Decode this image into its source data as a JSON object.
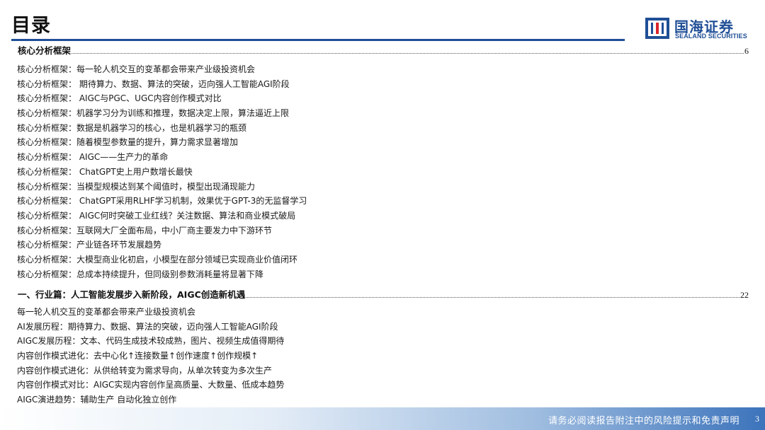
{
  "title": "目录",
  "logo": {
    "cn": "国海证券",
    "en": "SEALAND SECURITIES"
  },
  "sections": [
    {
      "heading": "核心分析框架",
      "page": "6",
      "items": [
        "核心分析框架：每一轮人机交互的变革都会带来产业级投资机会",
        "核心分析框架： 期待算力、数据、算法的突破，迈向强人工智能AGI阶段",
        "核心分析框架： AIGC与PGC、UGC内容创作模式对比",
        "核心分析框架：机器学习分为训练和推理，数据决定上限，算法逼近上限",
        "核心分析框架：数据是机器学习的核心，也是机器学习的瓶颈",
        "核心分析框架：随着模型参数量的提升，算力需求显著增加",
        "核心分析框架： AIGC——生产力的革命",
        "核心分析框架： ChatGPT史上用户数增长最快",
        "核心分析框架：当模型规模达到某个阈值时，模型出现涌现能力",
        "核心分析框架： ChatGPT采用RLHF学习机制，效果优于GPT-3的无监督学习",
        "核心分析框架： AIGC何时突破工业红线？关注数据、算法和商业模式破局",
        "核心分析框架：互联网大厂全面布局，中小厂商主要发力中下游环节",
        "核心分析框架：产业链各环节发展趋势",
        "核心分析框架：大模型商业化初启，小模型在部分领域已实现商业价值闭环",
        "核心分析框架：总成本持续提升，但同级别参数消耗量将显著下降"
      ]
    },
    {
      "heading": "一、行业篇：人工智能发展步入新阶段，AIGC创造新机遇",
      "page": "22",
      "items": [
        "每一轮人机交互的变革都会带来产业级投资机会",
        "AI发展历程：期待算力、数据、算法的突破，迈向强人工智能AGI阶段",
        "AIGC发展历程：文本、代码生成技术较成熟，图片、视频生成值得期待",
        "内容创作模式进化：去中心化↑连接数量↑创作速度↑创作规模↑",
        "内容创作模式进化：从供给转变为需求导向，从单次转变为多次生产",
        "内容创作模式对比：AIGC实现内容创作呈高质量、大数量、低成本趋势",
        "AIGC演进趋势：辅助生产   自动化独立创作"
      ]
    }
  ],
  "footer": {
    "disclaimer": "请务必阅读报告附注中的风险提示和免责声明",
    "page_number": "3"
  },
  "colors": {
    "brand_blue": "#1f4e96",
    "logo_red": "#d9252b",
    "footer_blue": "#3c73bb"
  }
}
